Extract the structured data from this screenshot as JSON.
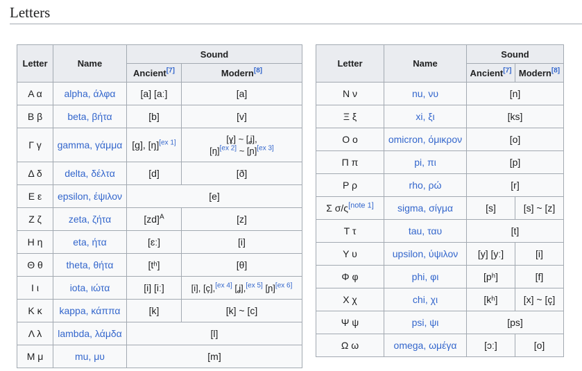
{
  "section": {
    "title": "Letters"
  },
  "headers": {
    "letter": "Letter",
    "name": "Name",
    "sound": "Sound",
    "ancient": "Ancient",
    "ancient_ref": "[7]",
    "modern": "Modern",
    "modern_ref": "[8]"
  },
  "left_rows": [
    {
      "letter": "Α α",
      "name": "alpha, άλφα",
      "ancient": "[a] [aː]",
      "modern": "[a]"
    },
    {
      "letter": "Β β",
      "name": "beta, βήτα",
      "ancient": "[b]",
      "modern": "[v]"
    },
    {
      "letter": "Γ γ",
      "name": "gamma, γάμμα",
      "ancient": "[ɡ], [ŋ]",
      "ancient_ref": "[ex 1]",
      "modern_l1": "[ɣ] ~ [ʝ],",
      "modern_l2a": "[ŋ]",
      "modern_l2a_ref": "[ex 2]",
      "modern_l2b": " ~ [ɲ]",
      "modern_l2b_ref": "[ex 3]"
    },
    {
      "letter": "Δ δ",
      "name": "delta, δέλτα",
      "ancient": "[d]",
      "modern": "[ð]"
    },
    {
      "letter": "Ε ε",
      "name": "epsilon, έψιλον",
      "sound": "[e]"
    },
    {
      "letter": "Ζ ζ",
      "name": "zeta, ζήτα",
      "ancient": "[zd]",
      "ancient_ref": "A",
      "modern": "[z]"
    },
    {
      "letter": "Η η",
      "name": "eta, ήτα",
      "ancient": "[ɛː]",
      "modern": "[i]"
    },
    {
      "letter": "Θ θ",
      "name": "theta, θήτα",
      "ancient": "[tʰ]",
      "modern": "[θ]"
    },
    {
      "letter": "Ι ι",
      "name": "iota, ιώτα",
      "ancient": "[i] [iː]",
      "modern_a": "[i], [ç],",
      "modern_a_ref": "[ex 4]",
      "modern_b": " [ʝ],",
      "modern_b_ref": "[ex 5]",
      "modern_c": " [ɲ]",
      "modern_c_ref": "[ex 6]"
    },
    {
      "letter": "Κ κ",
      "name": "kappa, κάππα",
      "ancient": "[k]",
      "modern": "[k] ~ [c]"
    },
    {
      "letter": "Λ λ",
      "name": "lambda, λάμδα",
      "sound": "[l]"
    },
    {
      "letter": "Μ μ",
      "name": "mu, μυ",
      "sound": "[m]"
    }
  ],
  "right_rows": [
    {
      "letter": "Ν ν",
      "name": "nu, νυ",
      "sound": "[n]"
    },
    {
      "letter": "Ξ ξ",
      "name": "xi, ξι",
      "sound": "[ks]"
    },
    {
      "letter": "Ο ο",
      "name": "omicron, όμικρον",
      "sound": "[o]"
    },
    {
      "letter": "Π π",
      "name": "pi, πι",
      "sound": "[p]"
    },
    {
      "letter": "Ρ ρ",
      "name": "rho, ρώ",
      "sound": "[r]"
    },
    {
      "letter": "Σ σ/ς",
      "letter_ref": "[note 1]",
      "name": "sigma, σίγμα",
      "ancient": "[s]",
      "modern": "[s] ~ [z]"
    },
    {
      "letter": "Τ τ",
      "name": "tau, ταυ",
      "sound": "[t]"
    },
    {
      "letter": "Υ υ",
      "name": "upsilon, ύψιλον",
      "ancient": "[y] [yː]",
      "modern": "[i]"
    },
    {
      "letter": "Φ φ",
      "name": "phi, φι",
      "ancient": "[pʰ]",
      "modern": "[f]"
    },
    {
      "letter": "Χ χ",
      "name": "chi, χι",
      "ancient": "[kʰ]",
      "modern": "[x] ~ [ç]"
    },
    {
      "letter": "Ψ ψ",
      "name": "psi, ψι",
      "sound": "[ps]"
    },
    {
      "letter": "Ω ω",
      "name": "omega, ωμέγα",
      "ancient": "[ɔː]",
      "modern": "[o]"
    }
  ]
}
